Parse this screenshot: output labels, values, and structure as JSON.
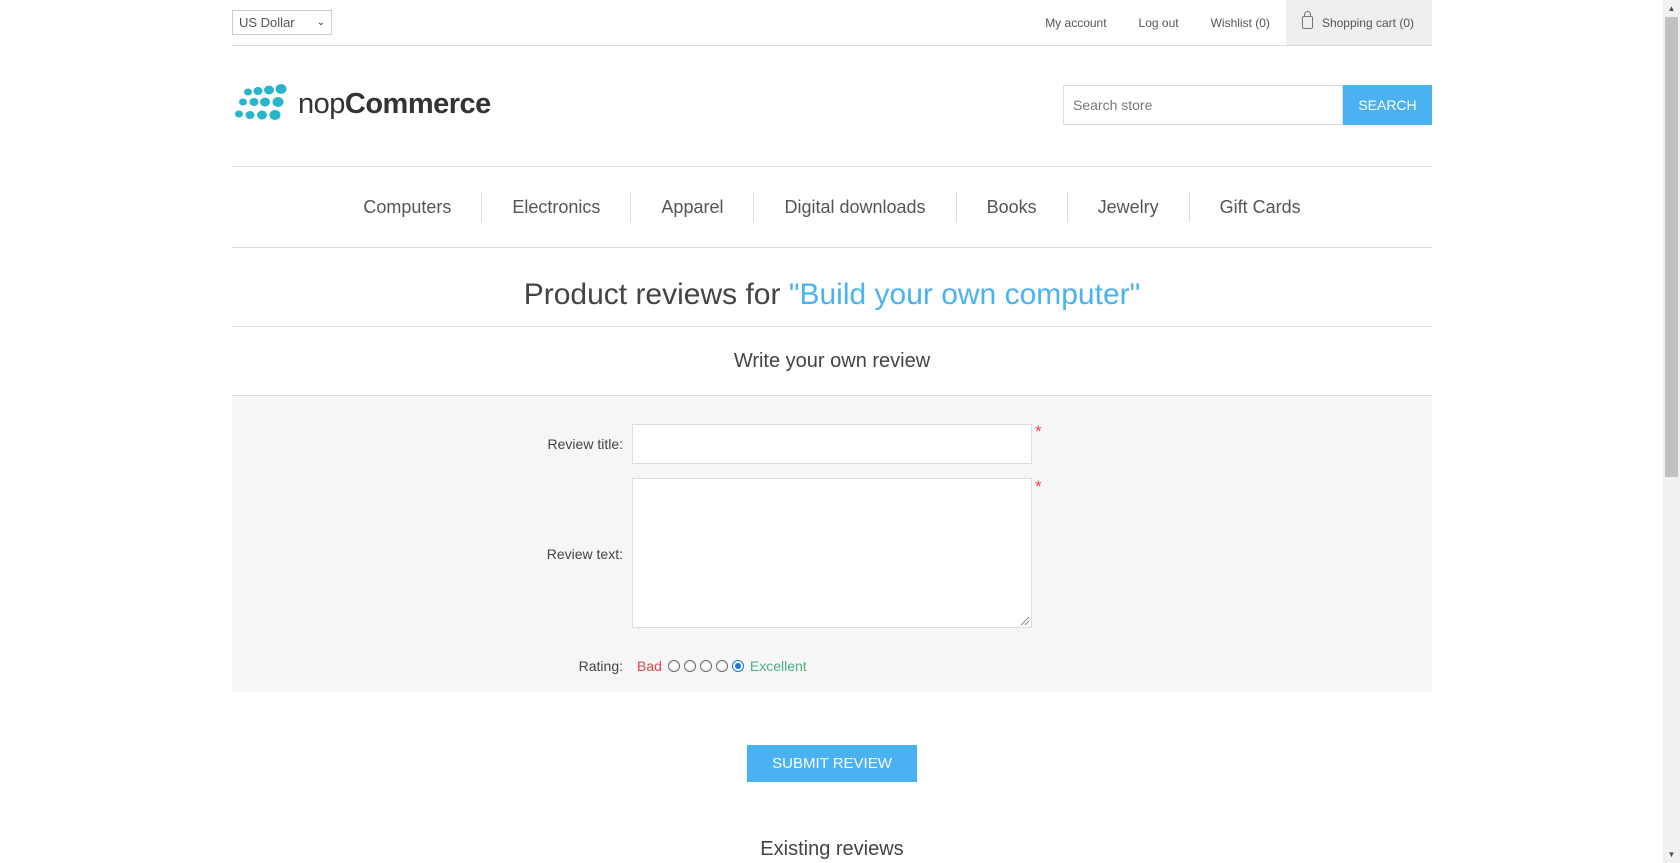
{
  "header": {
    "currency": "US Dollar",
    "links": {
      "my_account": "My account",
      "log_out": "Log out",
      "wishlist": "Wishlist (0)",
      "cart": "Shopping cart (0)"
    }
  },
  "logo": {
    "text_light": "nop",
    "text_bold": "Commerce",
    "color": "#29b4ce"
  },
  "search": {
    "placeholder": "Search store",
    "button": "SEARCH"
  },
  "nav": [
    "Computers",
    "Electronics",
    "Apparel",
    "Digital downloads",
    "Books",
    "Jewelry",
    "Gift Cards"
  ],
  "page": {
    "title_prefix": "Product reviews for ",
    "product_name": "\"Build your own computer\"",
    "write_title": "Write your own review",
    "existing_title": "Existing reviews"
  },
  "form": {
    "title_label": "Review title:",
    "text_label": "Review text:",
    "rating_label": "Rating:",
    "rating_bad": "Bad",
    "rating_excellent": "Excellent",
    "required_mark": "*",
    "rating_selected": 5,
    "submit": "SUBMIT REVIEW"
  },
  "colors": {
    "accent": "#4ab2f1",
    "bad": "#e4434b",
    "excellent": "#4cb17c"
  }
}
